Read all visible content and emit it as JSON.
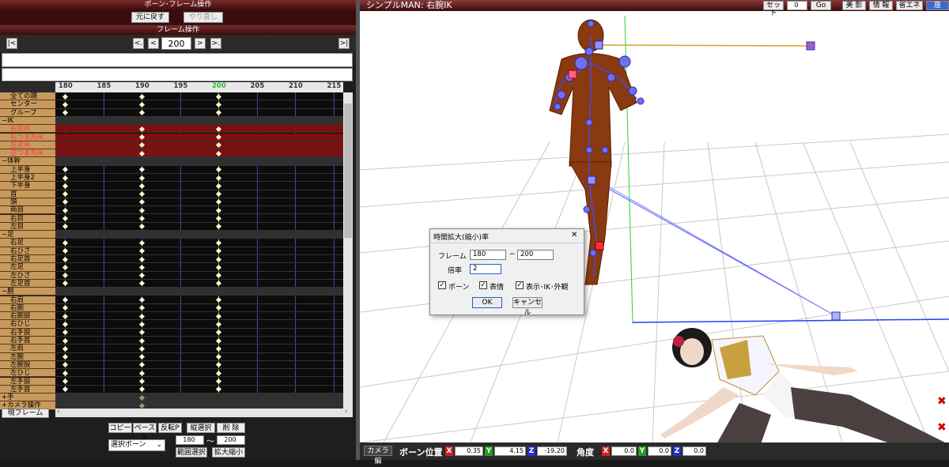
{
  "left_panel": {
    "title": "ボーン･フレーム操作",
    "undo_label": "元に戻す",
    "redo_label": "やり直し",
    "frame_ops_title": "フレーム操作",
    "frame_value": "200",
    "nav": {
      "first": "|<",
      "prev_key": "<.",
      "prev": "<",
      "next": ">",
      "next_key": ">.",
      "last": ">|"
    },
    "ruler_ticks": [
      "180",
      "185",
      "190",
      "195",
      "200",
      "205",
      "210",
      "215"
    ],
    "current_tick": "200",
    "rows": [
      {
        "label": "全ての親",
        "type": "bone",
        "keys": [
          0,
          2,
          4
        ]
      },
      {
        "label": "センター",
        "type": "bone",
        "keys": [
          0,
          2,
          4
        ]
      },
      {
        "label": "グルーブ",
        "type": "bone",
        "keys": [
          0,
          2,
          4
        ]
      },
      {
        "label": "−IK",
        "type": "group",
        "keys": []
      },
      {
        "label": "右足IK",
        "type": "red",
        "keys": [
          2,
          4
        ]
      },
      {
        "label": "右つま先IK",
        "type": "red",
        "keys": [
          2,
          4
        ]
      },
      {
        "label": "左足IK",
        "type": "red",
        "keys": [
          2,
          4
        ]
      },
      {
        "label": "左つま先IK",
        "type": "red",
        "keys": [
          2,
          4
        ]
      },
      {
        "label": "−体幹",
        "type": "group",
        "keys": []
      },
      {
        "label": "上半身",
        "type": "bone",
        "keys": [
          0,
          2,
          4
        ]
      },
      {
        "label": "上半身2",
        "type": "bone",
        "keys": [
          0,
          2,
          4
        ]
      },
      {
        "label": "下半身",
        "type": "bone",
        "keys": [
          0,
          2,
          4
        ]
      },
      {
        "label": "首",
        "type": "bone",
        "keys": [
          0,
          2,
          4
        ]
      },
      {
        "label": "頭",
        "type": "bone",
        "keys": [
          0,
          2,
          4
        ]
      },
      {
        "label": "両目",
        "type": "bone",
        "keys": [
          0,
          2,
          4
        ]
      },
      {
        "label": "右目",
        "type": "bone",
        "keys": [
          0,
          2,
          4
        ]
      },
      {
        "label": "左目",
        "type": "bone",
        "keys": [
          0,
          2,
          4
        ]
      },
      {
        "label": "−足",
        "type": "group",
        "keys": []
      },
      {
        "label": "右足",
        "type": "bone",
        "keys": [
          0,
          2,
          4
        ]
      },
      {
        "label": "右ひざ",
        "type": "bone",
        "keys": [
          0,
          2,
          4
        ]
      },
      {
        "label": "右足首",
        "type": "bone",
        "keys": [
          0,
          2,
          4
        ]
      },
      {
        "label": "左足",
        "type": "bone",
        "keys": [
          0,
          2,
          4
        ]
      },
      {
        "label": "左ひざ",
        "type": "bone",
        "keys": [
          0,
          2,
          4
        ]
      },
      {
        "label": "左足首",
        "type": "bone",
        "keys": [
          0,
          2,
          4
        ]
      },
      {
        "label": "−腕",
        "type": "group",
        "keys": []
      },
      {
        "label": "右肩",
        "type": "bone",
        "keys": [
          0,
          2,
          4
        ]
      },
      {
        "label": "右腕",
        "type": "bone",
        "keys": [
          0,
          2,
          4
        ]
      },
      {
        "label": "右腕捩",
        "type": "bone",
        "keys": [
          0,
          2,
          4
        ]
      },
      {
        "label": "右ひじ",
        "type": "bone",
        "keys": [
          0,
          2,
          4
        ]
      },
      {
        "label": "右手捩",
        "type": "bone",
        "keys": [
          0,
          2,
          4
        ]
      },
      {
        "label": "右手首",
        "type": "bone",
        "keys": [
          0,
          2,
          4
        ]
      },
      {
        "label": "左肩",
        "type": "bone",
        "keys": [
          0,
          2,
          4
        ]
      },
      {
        "label": "左腕",
        "type": "bone",
        "keys": [
          0,
          2,
          4
        ]
      },
      {
        "label": "左腕捩",
        "type": "bone",
        "keys": [
          0,
          2,
          4
        ]
      },
      {
        "label": "左ひじ",
        "type": "bone",
        "keys": [
          0,
          2,
          4
        ]
      },
      {
        "label": "左手捩",
        "type": "bone",
        "keys": [
          0,
          2,
          4
        ]
      },
      {
        "label": "左手首",
        "type": "bone",
        "keys": [
          0,
          2,
          4
        ]
      },
      {
        "label": "+手",
        "type": "group",
        "keys": [
          2
        ]
      },
      {
        "label": "+カメラ操作",
        "type": "group",
        "keys": [
          2
        ]
      }
    ],
    "current_frame_btn": "現フレーム",
    "copy": "コピー",
    "paste": "ペースト",
    "invert_paste": "反転P",
    "vertical_select": "縦選択",
    "delete": "削 除",
    "select_dropdown": "選択ボーン",
    "range_from": "180",
    "range_tilde": "〜",
    "range_to": "200",
    "range_select": "範囲選択",
    "scale": "拡大縮小"
  },
  "viewport": {
    "title": "シンプルMAN: 右腕IK",
    "set_label": "セット",
    "set_value": "0",
    "go_label": "Go",
    "btn_beauty": "美 影",
    "btn_info": "情 報",
    "btn_eco": "省エネ",
    "btn_extra": "座"
  },
  "status_bar": {
    "camera_btn": "カメラ編",
    "bone_pos_label": "ボーン位置",
    "pos_x": "0.35",
    "pos_y": "4.15",
    "pos_z": "-19.20",
    "angle_label": "角度",
    "ang_x": "0.0",
    "ang_y": "0.0",
    "ang_z": "0.0",
    "x": "X",
    "y": "Y",
    "z": "Z"
  },
  "dialog": {
    "title": "時間拡大(縮小)率",
    "close": "✕",
    "frame_label": "フレーム",
    "frame_from": "180",
    "dash": "−",
    "frame_to": "200",
    "rate_label": "倍率",
    "rate_value": "2",
    "chk_bone": "ボーン",
    "chk_face": "表情",
    "chk_display": "表示･IK･外観",
    "ok": "OK",
    "cancel": "キャンセル"
  },
  "colors": {
    "accent_red": "#7a2a2a",
    "key": "#fff5c8",
    "bone_blue": "#4a4ae0"
  }
}
